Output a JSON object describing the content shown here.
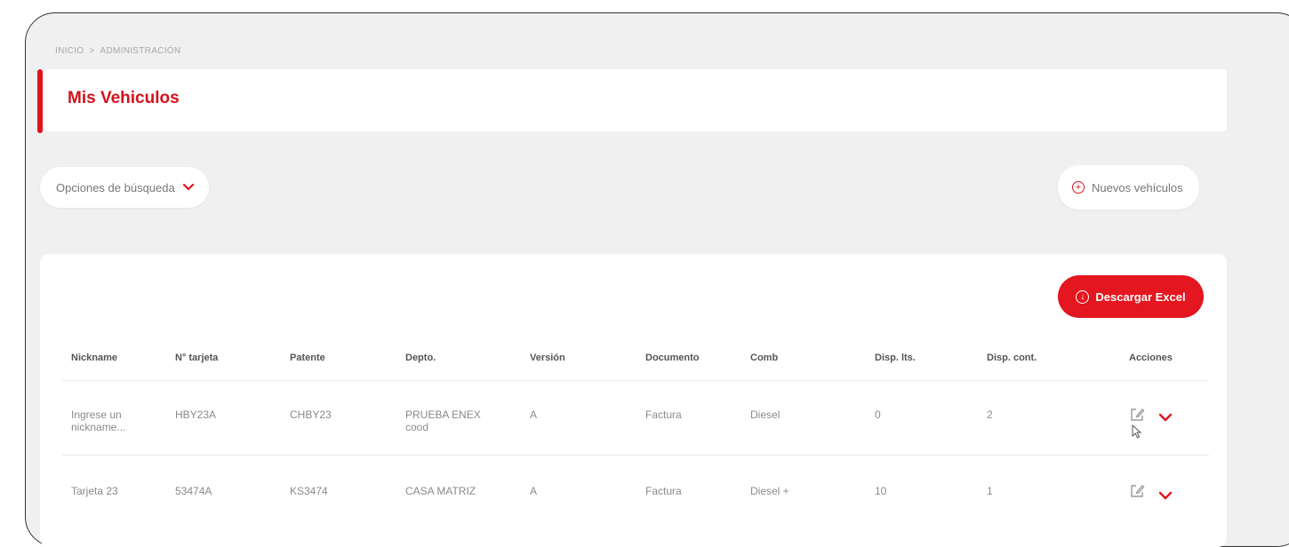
{
  "breadcrumb": {
    "home": "INICIO",
    "separator": ">",
    "current": "ADMINISTRACIÓN"
  },
  "page_title": "Mis Vehiculos",
  "search_options": {
    "label": "Opciones de búsqueda"
  },
  "new_vehicles": {
    "label": "Nuevos vehículos"
  },
  "download_excel": {
    "label": "Descargar Excel"
  },
  "table": {
    "columns": [
      "Nickname",
      "N° tarjeta",
      "Patente",
      "Depto.",
      "Versión",
      "Documento",
      "Comb",
      "Disp. lts.",
      "Disp. cont.",
      "Acciones"
    ],
    "rows": [
      {
        "nickname": "Ingrese un nickname...",
        "tarjeta": "HBY23A",
        "patente": "CHBY23",
        "depto": "PRUEBA ENEX cood",
        "version": "A",
        "documento": "Factura",
        "comb": "Diesel",
        "disp_lts": "0",
        "disp_cont": "2"
      },
      {
        "nickname": "Tarjeta 23",
        "tarjeta": "53474A",
        "patente": "KS3474",
        "depto": "CASA MATRIZ",
        "version": "A",
        "documento": "Factura",
        "comb": "Diesel +",
        "disp_lts": "10",
        "disp_cont": "1"
      }
    ]
  },
  "colors": {
    "accent": "#e0141e",
    "background": "#f0f0f0",
    "card": "#ffffff"
  }
}
